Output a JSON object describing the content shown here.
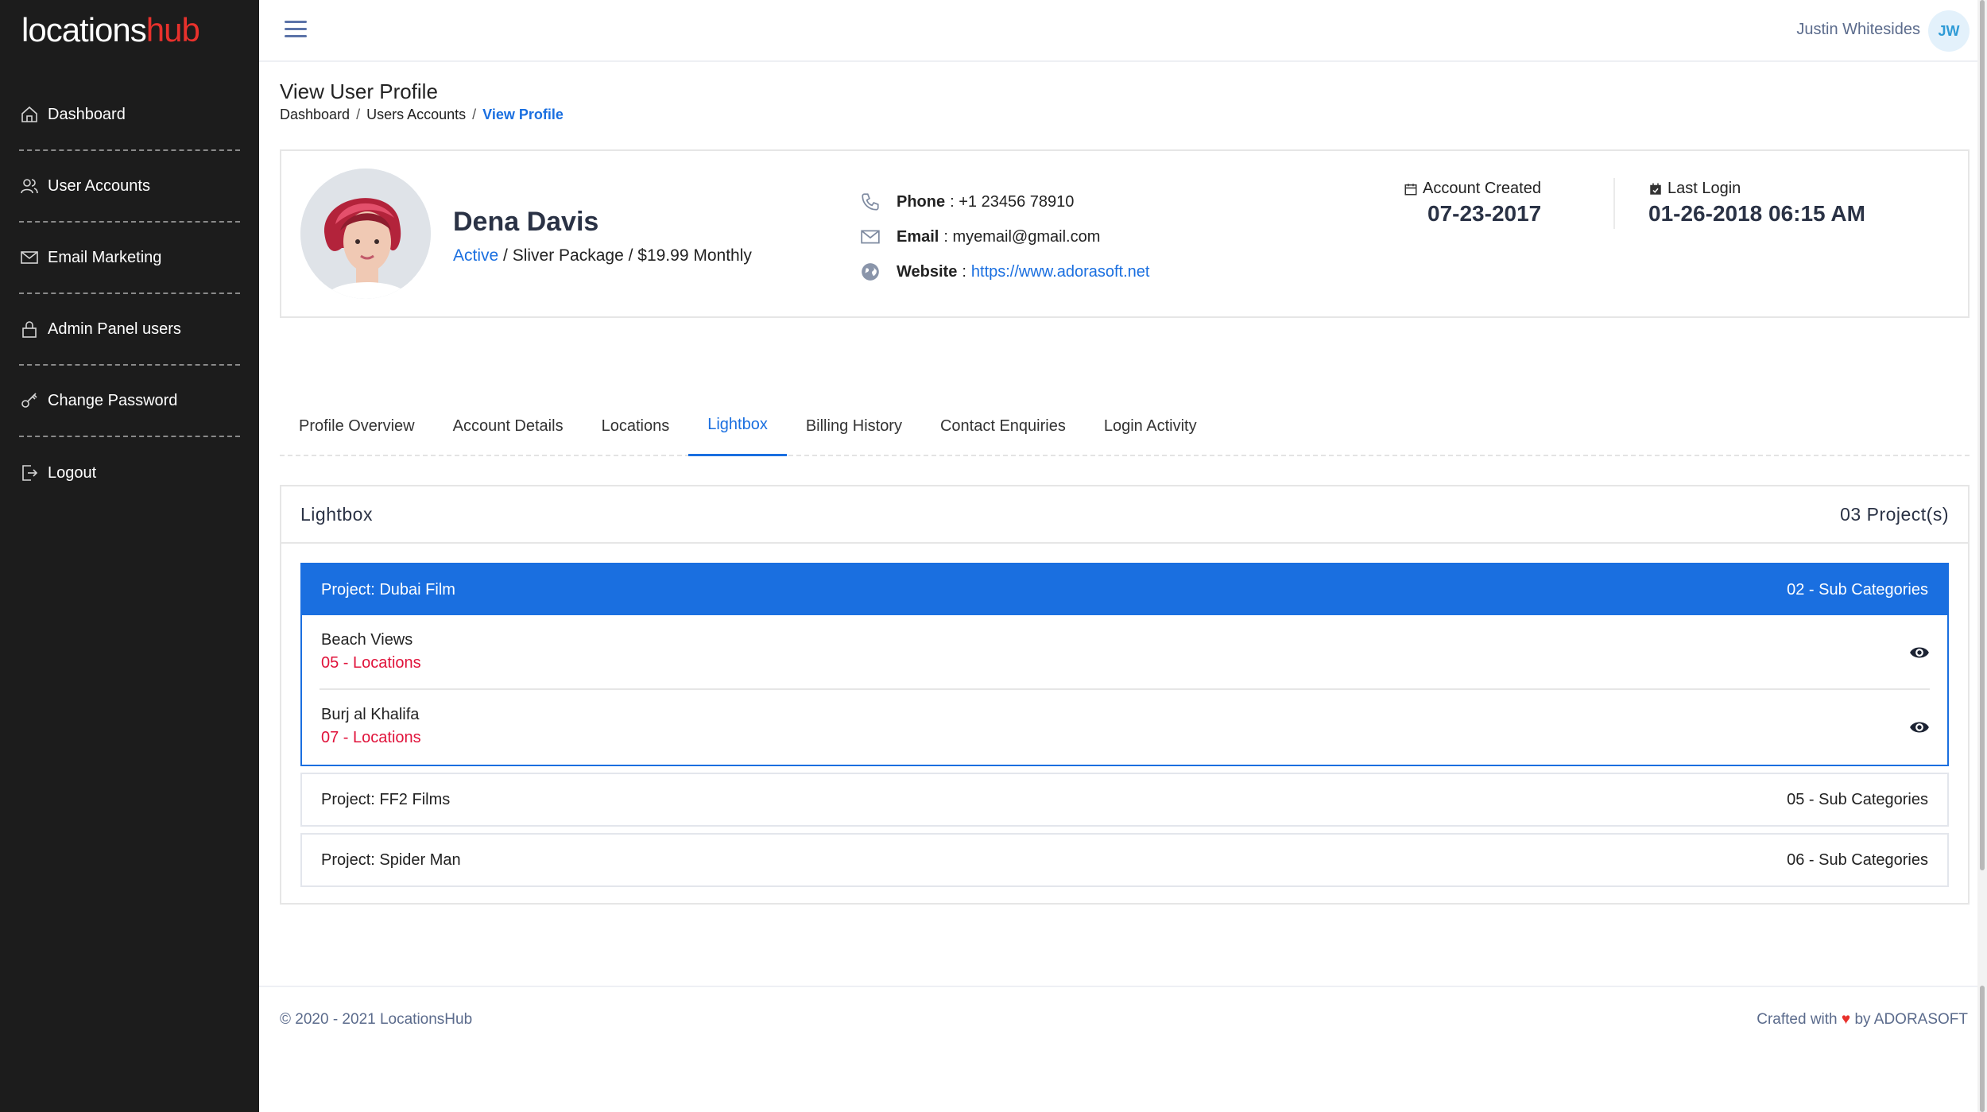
{
  "brand": {
    "part1": "locations",
    "part2": "hub"
  },
  "sidebar": {
    "items": [
      {
        "label": "Dashboard",
        "icon": "home-icon"
      },
      {
        "label": "User Accounts",
        "icon": "users-icon"
      },
      {
        "label": "Email Marketing",
        "icon": "mail-icon"
      },
      {
        "label": "Admin Panel users",
        "icon": "lock-icon"
      },
      {
        "label": "Change Password",
        "icon": "key-icon"
      },
      {
        "label": "Logout",
        "icon": "logout-icon"
      }
    ]
  },
  "topbar": {
    "user_name": "Justin Whitesides",
    "user_initials": "JW"
  },
  "page": {
    "title": "View User Profile",
    "breadcrumb": [
      "Dashboard",
      "Users Accounts",
      "View Profile"
    ],
    "breadcrumb_sep": "/"
  },
  "profile": {
    "name": "Dena Davis",
    "status": "Active",
    "package": "/ Sliver Package / $19.99 Monthly",
    "phone_label": "Phone",
    "phone": ": +1 23456 78910",
    "email_label": "Email",
    "email": ": myemail@gmail.com",
    "website_label": "Website",
    "website_sep": ":",
    "website": "https://www.adorasoft.net",
    "account_created_label": "Account Created",
    "account_created": "07-23-2017",
    "last_login_label": "Last Login",
    "last_login": "01-26-2018 06:15 AM"
  },
  "tabs": [
    "Profile Overview",
    "Account Details",
    "Locations",
    "Lightbox",
    "Billing History",
    "Contact Enquiries",
    "Login Activity"
  ],
  "lightbox": {
    "title": "Lightbox",
    "count": "03 Project(s)",
    "projects": [
      {
        "name": "Project: Dubai Film",
        "sub_count": "02 - Sub Categories",
        "subs": [
          {
            "name": "Beach Views",
            "locations": "05 - Locations"
          },
          {
            "name": "Burj al Khalifa",
            "locations": "07 - Locations"
          }
        ]
      },
      {
        "name": "Project: FF2 Films",
        "sub_count": "05 - Sub Categories"
      },
      {
        "name": "Project: Spider Man",
        "sub_count": "06 - Sub Categories"
      }
    ]
  },
  "footer": {
    "copyright": "© 2020 - 2021 LocationsHub",
    "crafted": "Crafted with",
    "heart": "♥",
    "by": "by ADORASOFT"
  },
  "colors": {
    "accent": "#1a6fe0",
    "sidebar_bg": "#1c1c1c",
    "brand_red": "#e8312c",
    "location_red": "#e0123a"
  }
}
